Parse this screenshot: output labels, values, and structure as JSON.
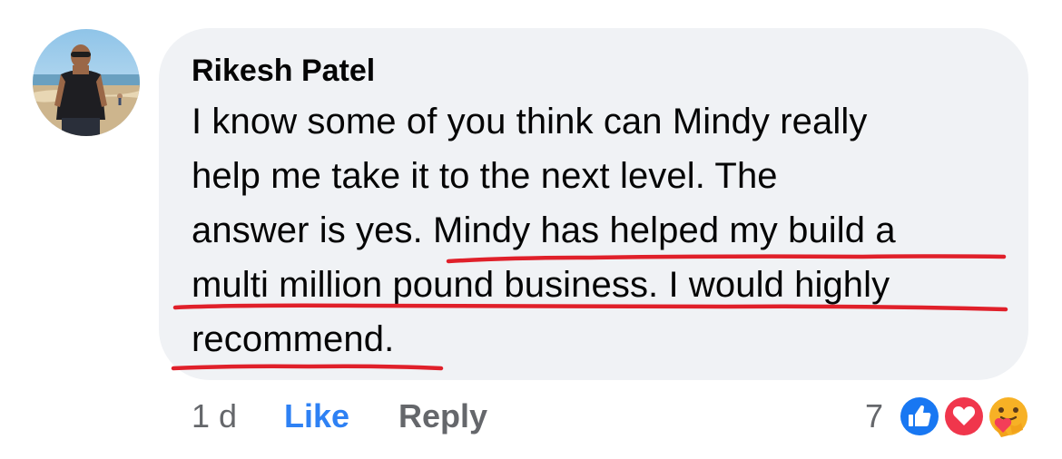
{
  "comment": {
    "author": "Rikesh Patel",
    "lines": [
      "I know some of you think can Mindy really",
      "help me take it to the next level. The",
      "answer is yes. Mindy has helped my build a",
      "multi million pound business. I would highly",
      "recommend."
    ],
    "time": "1 d",
    "like_label": "Like",
    "reply_label": "Reply",
    "reaction_count": "7",
    "reactions": [
      "like-icon",
      "love-icon",
      "care-icon"
    ],
    "highlight_color": "#e0202a"
  }
}
